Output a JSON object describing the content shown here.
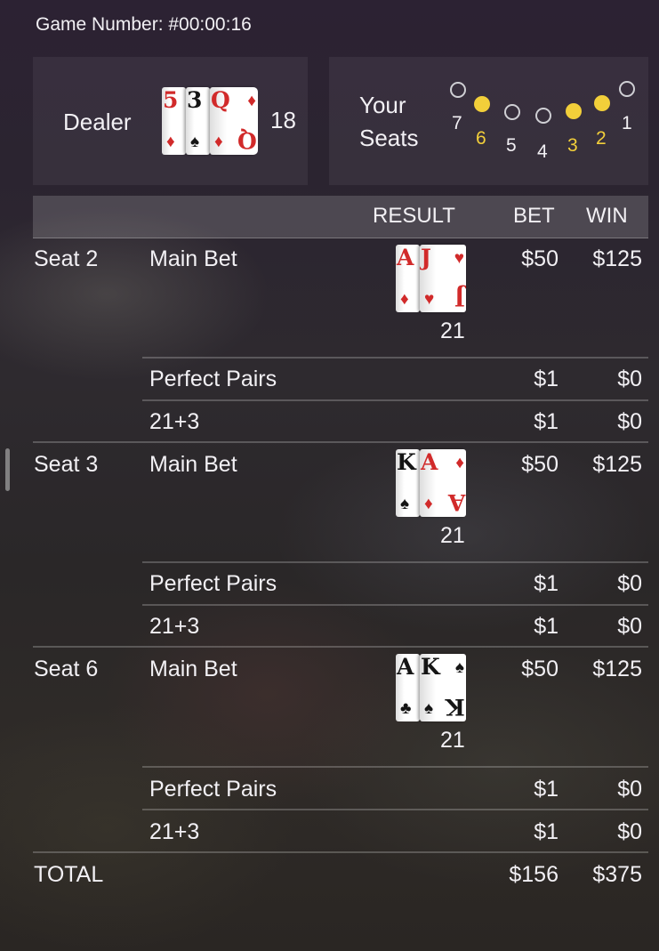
{
  "game_number_label": "Game Number: #00:00:16",
  "dealer": {
    "label": "Dealer",
    "total": "18",
    "cards": [
      {
        "rank": "5",
        "suit": "♦",
        "color": "red"
      },
      {
        "rank": "3",
        "suit": "♠",
        "color": "black"
      },
      {
        "rank": "Q",
        "suit": "♦",
        "color": "red"
      }
    ]
  },
  "your_seats": {
    "label_line1": "Your",
    "label_line2": "Seats",
    "seats": [
      {
        "num": "7",
        "taken": false
      },
      {
        "num": "6",
        "taken": true
      },
      {
        "num": "5",
        "taken": false
      },
      {
        "num": "4",
        "taken": false
      },
      {
        "num": "3",
        "taken": true
      },
      {
        "num": "2",
        "taken": true
      },
      {
        "num": "1",
        "taken": false
      }
    ]
  },
  "table": {
    "headers": {
      "result": "RESULT",
      "bet": "BET",
      "win": "WIN"
    },
    "seats": [
      {
        "seat": "Seat 2",
        "main_bet": {
          "label": "Main Bet",
          "bet": "$50",
          "win": "$125",
          "hand_total": "21",
          "cards": [
            {
              "rank": "A",
              "suit": "♦",
              "color": "red"
            },
            {
              "rank": "J",
              "suit": "♥",
              "color": "red"
            }
          ]
        },
        "perfect_pairs": {
          "label": "Perfect Pairs",
          "bet": "$1",
          "win": "$0"
        },
        "twentyone_three": {
          "label": "21+3",
          "bet": "$1",
          "win": "$0"
        }
      },
      {
        "seat": "Seat 3",
        "main_bet": {
          "label": "Main Bet",
          "bet": "$50",
          "win": "$125",
          "hand_total": "21",
          "cards": [
            {
              "rank": "K",
              "suit": "♠",
              "color": "black"
            },
            {
              "rank": "A",
              "suit": "♦",
              "color": "red"
            }
          ]
        },
        "perfect_pairs": {
          "label": "Perfect Pairs",
          "bet": "$1",
          "win": "$0"
        },
        "twentyone_three": {
          "label": "21+3",
          "bet": "$1",
          "win": "$0"
        }
      },
      {
        "seat": "Seat 6",
        "main_bet": {
          "label": "Main Bet",
          "bet": "$50",
          "win": "$125",
          "hand_total": "21",
          "cards": [
            {
              "rank": "A",
              "suit": "♣",
              "color": "black"
            },
            {
              "rank": "K",
              "suit": "♠",
              "color": "black"
            }
          ]
        },
        "perfect_pairs": {
          "label": "Perfect Pairs",
          "bet": "$1",
          "win": "$0"
        },
        "twentyone_three": {
          "label": "21+3",
          "bet": "$1",
          "win": "$0"
        }
      }
    ],
    "total": {
      "label": "TOTAL",
      "bet": "$156",
      "win": "$375"
    }
  },
  "colors": {
    "seat_taken": "#f2cf3a",
    "card_red": "#d12a2a",
    "card_black": "#151515"
  }
}
